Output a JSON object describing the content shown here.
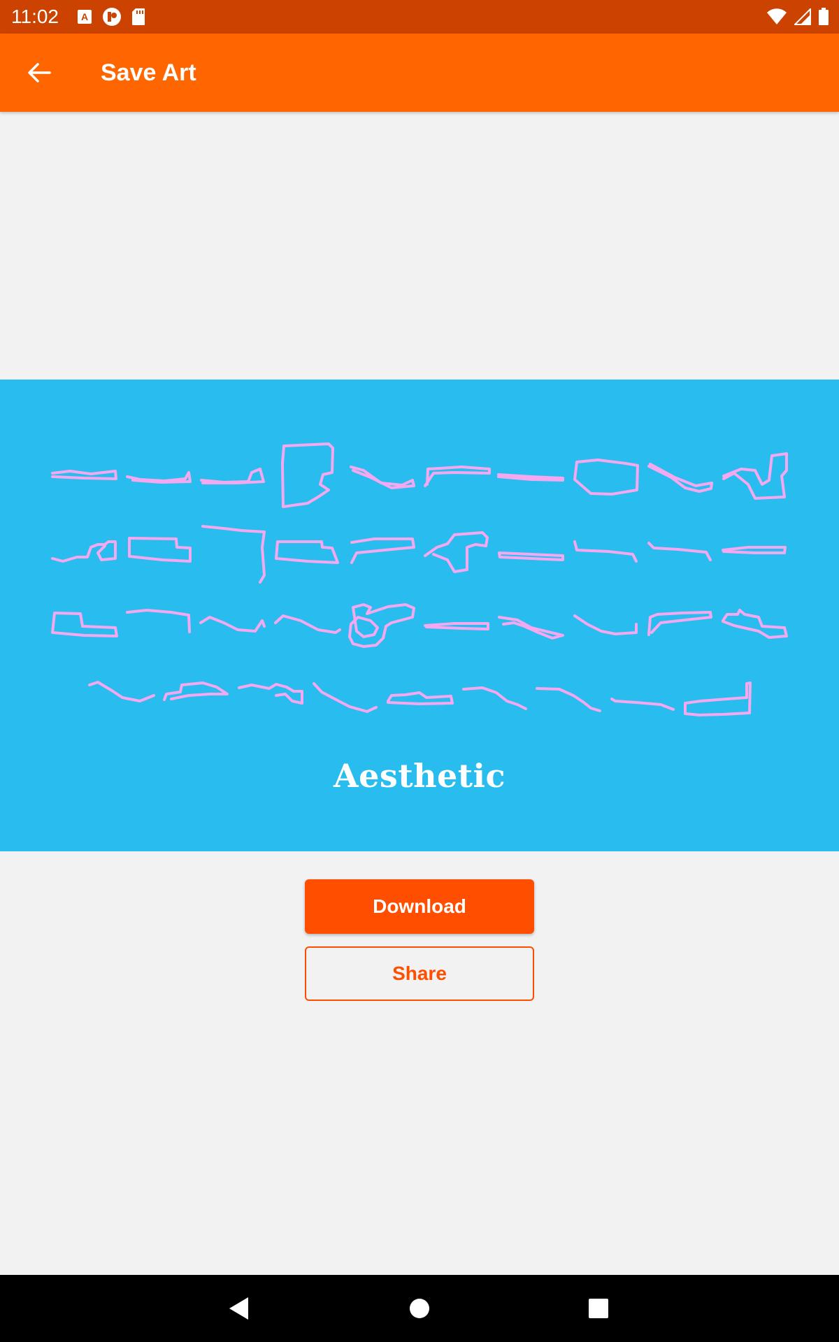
{
  "status_bar": {
    "time": "11:02",
    "left_icons": [
      "font-notification-icon",
      "media-notification-icon",
      "sd-card-icon"
    ],
    "right_icons": [
      "wifi-icon",
      "cell-signal-icon",
      "battery-icon"
    ]
  },
  "app_bar": {
    "back_icon": "arrow-back-icon",
    "title": "Save Art"
  },
  "art": {
    "background_color": "#28bdee",
    "stroke_color": "#f4a8f0",
    "caption": "Aesthetic"
  },
  "actions": {
    "download_label": "Download",
    "share_label": "Share",
    "accent_color": "#ff4e00"
  },
  "nav_bar": {
    "icons": [
      "nav-back-icon",
      "nav-home-icon",
      "nav-recents-icon"
    ]
  }
}
